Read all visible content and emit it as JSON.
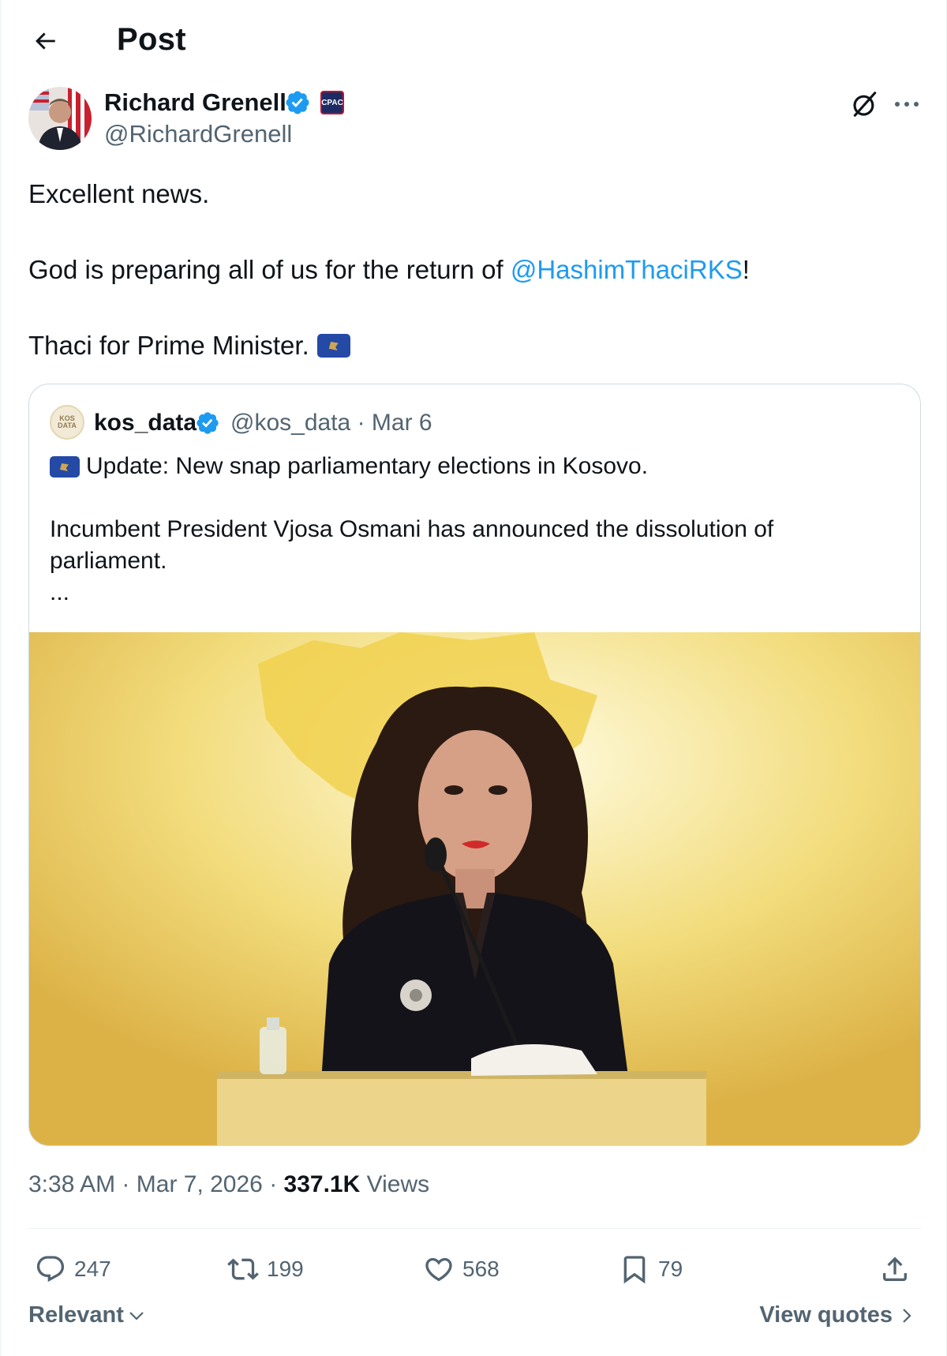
{
  "header": {
    "title": "Post"
  },
  "author": {
    "name": "Richard Grenell",
    "handle": "@RichardGrenell",
    "verified_color": "#1d9bf0"
  },
  "post": {
    "line1": "Excellent news.",
    "line2_prefix": "God is preparing all of us for the return of ",
    "line2_mention": "@HashimThaciRKS",
    "line2_suffix": "!",
    "line3": "Thaci for Prime Minister."
  },
  "quote": {
    "avatar_text": "KOS DATA",
    "name": "kos_data",
    "handle": "@kos_data",
    "separator": "·",
    "date": "Mar 6",
    "line1": "Update: New snap parliamentary elections in Kosovo.",
    "line2": "Incumbent President Vjosa Osmani has announced the dissolution of",
    "line3": "parliament.",
    "ellipsis": "..."
  },
  "meta": {
    "time": "3:38 AM",
    "sep1": "·",
    "date": "Mar 7, 2026",
    "sep2": "·",
    "views_count": "337.1K",
    "views_label": "Views"
  },
  "actions": {
    "replies": "247",
    "reposts": "199",
    "likes": "568",
    "bookmarks": "79"
  },
  "footer": {
    "sort_label": "Relevant",
    "view_quotes": "View quotes"
  },
  "colors": {
    "accent": "#1d9bf0",
    "text": "#0f1419",
    "muted": "#536471",
    "kosovo_blue": "#244aa5",
    "kosovo_gold": "#d0a650"
  }
}
